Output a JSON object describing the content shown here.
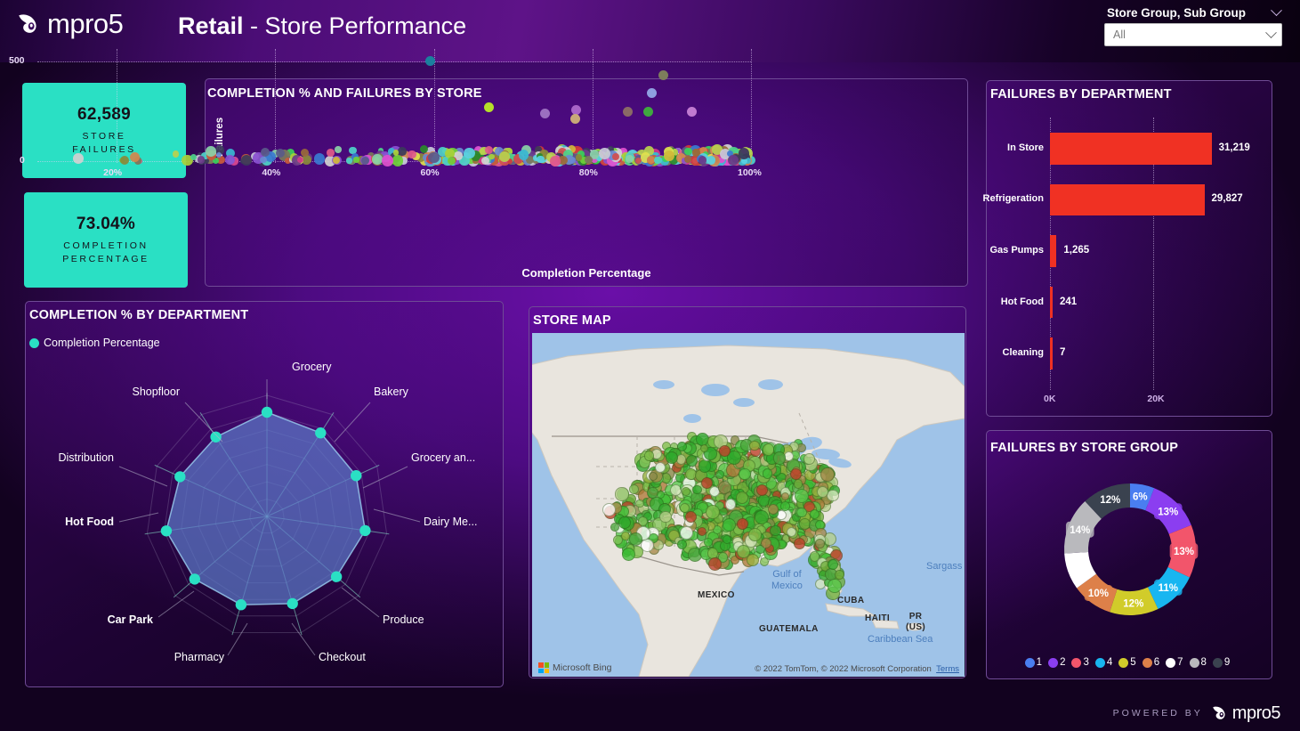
{
  "header": {
    "brand": "mpro5",
    "brand_icon": "mpro5-bird-logo",
    "title_strong": "Retail",
    "title_light": " - Store Performance"
  },
  "slicer": {
    "label": "Store Group, Sub Group",
    "value": "All",
    "expand_icon": "chevron-down-icon",
    "dropdown_icon": "chevron-down-icon"
  },
  "kpis": [
    {
      "value": "62,589",
      "label": "STORE\nFAILURES",
      "label_line1": "STORE",
      "label_line2": "FAILURES"
    },
    {
      "value": "73.04%",
      "label_line1": "COMPLETION",
      "label_line2": "PERCENTAGE"
    }
  ],
  "scatter": {
    "title": "COMPLETION % AND FAILURES BY STORE",
    "y_title": "Failures",
    "x_title": "Completion Percentage"
  },
  "radar": {
    "title": "COMPLETION % BY DEPARTMENT",
    "legend": "Completion Percentage"
  },
  "map": {
    "title": "STORE MAP",
    "bing_label": "Microsoft Bing",
    "attribution": "© 2022 TomTom, © 2022 Microsoft Corporation",
    "terms": "Terms",
    "places": [
      "MEXICO",
      "CUBA",
      "HAITI",
      "PR (US)",
      "GUATEMALA"
    ],
    "water": [
      "Gulf of Mexico",
      "Caribbean Sea",
      "Sargass"
    ]
  },
  "bars": {
    "title": "FAILURES BY DEPARTMENT"
  },
  "donut": {
    "title": "FAILURES BY STORE GROUP"
  },
  "footer": {
    "powered_by": "POWERED BY",
    "brand": "mpro5"
  },
  "chart_data": [
    {
      "type": "scatter",
      "title": "COMPLETION % AND FAILURES BY STORE",
      "xlabel": "Completion Percentage",
      "ylabel": "Failures",
      "xlim": [
        10,
        100
      ],
      "ylim": [
        0,
        560
      ],
      "xticks": [
        "20%",
        "40%",
        "60%",
        "80%",
        "100%"
      ],
      "xtick_values": [
        20,
        40,
        60,
        80,
        100
      ],
      "yticks": [
        "0",
        "500"
      ],
      "ytick_values": [
        0,
        500
      ],
      "grid": true,
      "legend": "none",
      "note": "Several hundred stores; one store per point, multicoloured by store. Vast majority cluster at Failures < 60 across 40%-100% completion. Visible outliers listed below.",
      "outliers": [
        {
          "x": 59.5,
          "y": 500,
          "color": "#1b7f9e"
        },
        {
          "x": 89.0,
          "y": 430,
          "color": "#7d7d5c"
        },
        {
          "x": 87.5,
          "y": 340,
          "color": "#8f9fe0"
        },
        {
          "x": 67.0,
          "y": 270,
          "color": "#b6e02a"
        },
        {
          "x": 78.0,
          "y": 255,
          "color": "#a864c8"
        },
        {
          "x": 87.0,
          "y": 245,
          "color": "#3fa83f"
        },
        {
          "x": 92.5,
          "y": 245,
          "color": "#c07ad0"
        },
        {
          "x": 84.5,
          "y": 245,
          "color": "#8a6a66"
        },
        {
          "x": 77.8,
          "y": 210,
          "color": "#c8a878"
        },
        {
          "x": 74.0,
          "y": 240,
          "color": "#9b6fc0"
        }
      ]
    },
    {
      "type": "radar",
      "title": "COMPLETION % BY DEPARTMENT",
      "series_name": "Completion Percentage",
      "categories": [
        "Grocery",
        "Bakery",
        "Grocery an...",
        "Dairy Me...",
        "Produce",
        "Checkout",
        "Pharmacy",
        "Car Park",
        "Hot Food",
        "Distribution",
        "Shopfloor"
      ],
      "values": [
        86,
        82,
        81,
        82,
        76,
        75,
        76,
        79,
        84,
        79,
        78
      ],
      "rmax": 100,
      "fill_color": "#5b78c8",
      "marker_color": "#2ae0c4"
    },
    {
      "type": "bar",
      "orientation": "horizontal",
      "title": "FAILURES BY DEPARTMENT",
      "categories": [
        "In Store",
        "Refrigeration",
        "Gas Pumps",
        "Hot Food",
        "Cleaning"
      ],
      "values": [
        31219,
        29827,
        1265,
        241,
        7
      ],
      "value_labels": [
        "31,219",
        "29,827",
        "1,265",
        "241",
        "7"
      ],
      "xticks": [
        "0K",
        "20K"
      ],
      "xtick_values": [
        0,
        20000
      ],
      "xlim": [
        0,
        33000
      ],
      "bar_color": "#f03123",
      "grid": true
    },
    {
      "type": "pie",
      "subtype": "donut",
      "title": "FAILURES BY STORE GROUP",
      "labels": [
        "1",
        "2",
        "3",
        "4",
        "5",
        "6",
        "7",
        "8",
        "9"
      ],
      "values": [
        6,
        13,
        13,
        11,
        12,
        10,
        9,
        14,
        12
      ],
      "value_labels": [
        "6%",
        "13%",
        "13%",
        "11%",
        "12%",
        "10%",
        "",
        "14%",
        "12%"
      ],
      "colors": [
        "#4a7ef0",
        "#8b3ef0",
        "#f2556b",
        "#18b6f0",
        "#d1cc2a",
        "#dd8049",
        "#ffffff",
        "#b9b9bd",
        "#3a424f"
      ],
      "legend_position": "bottom"
    },
    {
      "type": "scatter",
      "subtype": "map",
      "title": "STORE MAP",
      "basemap": "Microsoft Bing (road/terrain, North America)",
      "note": "Several hundred store bubbles concentrated over the continental United States, coloured on a green (high completion) to red/brown (low completion) scale; densest in the Midwest, South-East and Florida.",
      "color_scale": [
        "#2aa832",
        "#8a9a3a",
        "#b07a3a",
        "#c0402a",
        "#ffffff"
      ]
    }
  ]
}
